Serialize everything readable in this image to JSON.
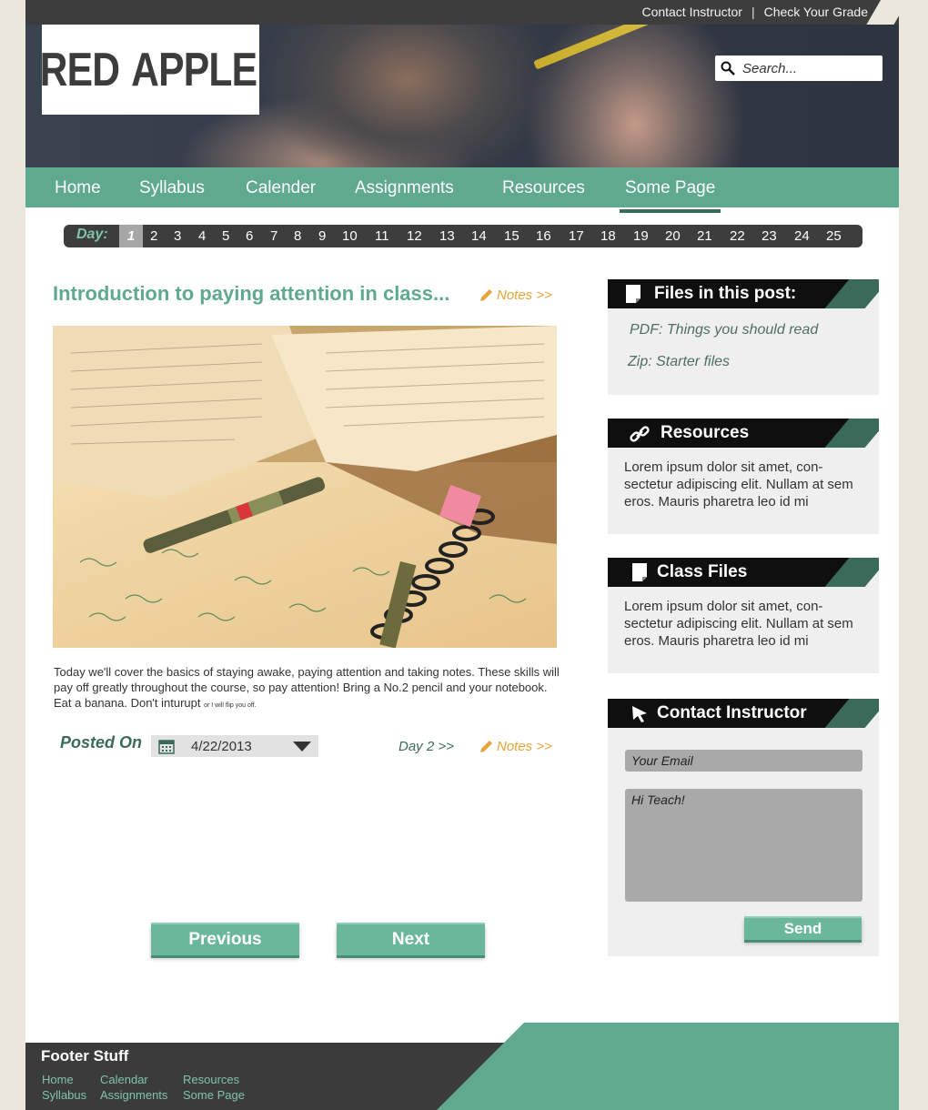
{
  "top_links": {
    "contact": "Contact Instructor",
    "grade": "Check Your Grade",
    "separator": "|"
  },
  "logo": {
    "left": "RED",
    "right": "APPLE"
  },
  "search": {
    "placeholder": "Search..."
  },
  "nav": [
    "Home",
    "Syllabus",
    "Calender",
    "Assignments",
    "Resources",
    "Some Page"
  ],
  "nav_active": "Some Page",
  "daybar": {
    "label": "Day:",
    "days": [
      "1",
      "2",
      "3",
      "4",
      "5",
      "6",
      "7",
      "8",
      "9",
      "10",
      "11",
      "12",
      "13",
      "14",
      "15",
      "16",
      "17",
      "18",
      "19",
      "20",
      "21",
      "22",
      "23",
      "24",
      "25"
    ],
    "active": "1"
  },
  "post": {
    "title": "Introduction to paying attention in class...",
    "notes_label": "Notes >>",
    "body": "Today we'll cover the basics of staying awake, paying attention and taking notes. These skills will pay off greatly throughout the course, so pay attention! Bring a No.2 pencil and your notebook. Eat a banana. Don't inturupt",
    "body_small": "or I will flip you off.",
    "posted_on_label": "Posted On",
    "date": "4/22/2013",
    "next_day_link": "Day 2 >>",
    "bottom_notes_label": "Notes >>"
  },
  "buttons": {
    "previous": "Previous",
    "next": "Next",
    "send": "Send"
  },
  "sidebar": {
    "files": {
      "title": "Files in this post:",
      "items": [
        "PDF: Things you should read",
        "Zip: Starter files"
      ]
    },
    "resources": {
      "title": "Resources",
      "text": "Lorem ipsum dolor sit amet, con- sectetur adipiscing elit. Nullam at sem eros. Mauris pharetra leo id mi"
    },
    "class_files": {
      "title": "Class Files",
      "text": "Lorem ipsum dolor sit amet, con- sectetur adipiscing elit. Nullam at sem eros. Mauris pharetra leo id mi"
    },
    "contact": {
      "title": "Contact Instructor",
      "email_placeholder": "Your Email",
      "message_placeholder": "Hi Teach!"
    }
  },
  "footer": {
    "title": "Footer Stuff",
    "links": [
      "Home",
      "Syllabus",
      "Calendar",
      "Assignments",
      "Resources",
      "Some Page"
    ]
  },
  "colors": {
    "accent": "#5fa98f",
    "accent_dark": "#3a6b5a",
    "notes": "#e6a43a",
    "dark": "#3d3d3d"
  }
}
